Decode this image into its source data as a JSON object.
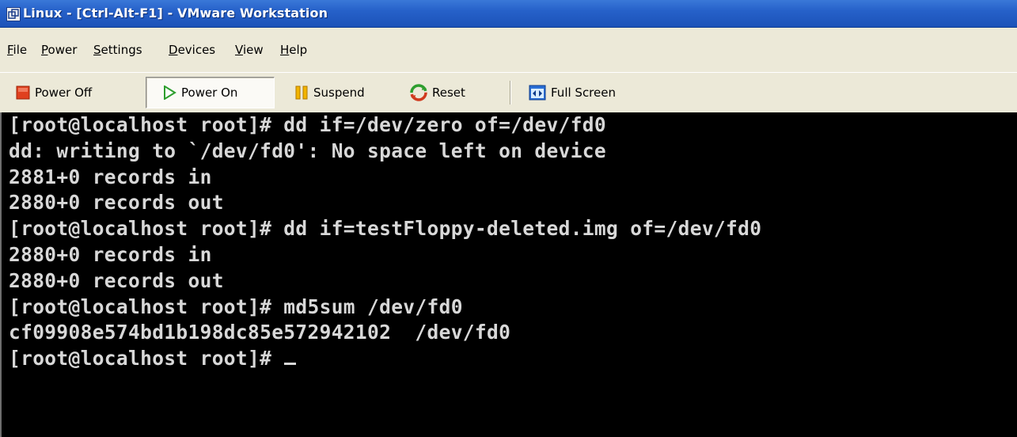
{
  "window": {
    "title": "Linux - [Ctrl-Alt-F1] - VMware Workstation",
    "icon": "vmware-icon"
  },
  "menu": {
    "items": [
      {
        "label": "File",
        "accel": "F",
        "rest": "ile"
      },
      {
        "label": "Power",
        "accel": "P",
        "rest": "ower"
      },
      {
        "label": "Settings",
        "accel": "S",
        "rest": "ettings"
      },
      {
        "label": "Devices",
        "accel": "D",
        "rest": "evices"
      },
      {
        "label": "View",
        "accel": "V",
        "rest": "iew"
      },
      {
        "label": "Help",
        "accel": "H",
        "rest": "elp"
      }
    ]
  },
  "toolbar": {
    "power_off": {
      "label": "Power Off",
      "icon": "power-off-icon",
      "color": "#e03c1c"
    },
    "power_on": {
      "label": "Power On",
      "icon": "power-on-icon",
      "color": "#2e9e2e"
    },
    "suspend": {
      "label": "Suspend",
      "icon": "suspend-icon",
      "color": "#f0a800"
    },
    "reset": {
      "label": "Reset",
      "icon": "reset-icon"
    },
    "full_screen": {
      "label": "Full Screen",
      "icon": "full-screen-icon"
    }
  },
  "console": {
    "lines": [
      "[root@localhost root]# dd if=/dev/zero of=/dev/fd0",
      "dd: writing to `/dev/fd0': No space left on device",
      "2881+0 records in",
      "2880+0 records out",
      "[root@localhost root]# dd if=testFloppy-deleted.img of=/dev/fd0",
      "2880+0 records in",
      "2880+0 records out",
      "[root@localhost root]# md5sum /dev/fd0",
      "cf09908e574bd1b198dc85e572942102  /dev/fd0",
      "[root@localhost root]# "
    ],
    "text_color": "#d8d8d8",
    "background": "#000000"
  }
}
